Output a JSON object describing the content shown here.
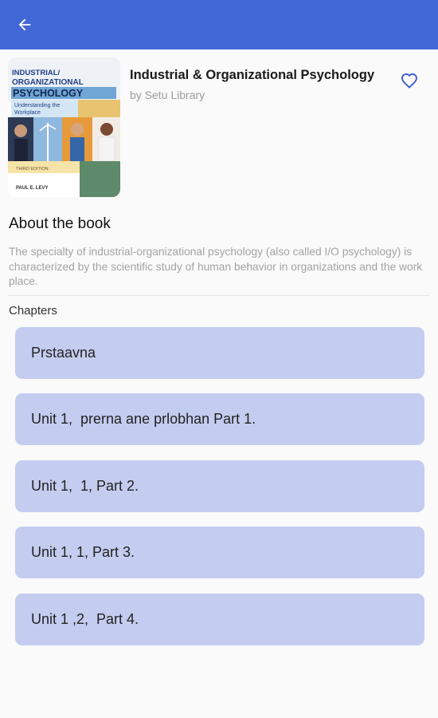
{
  "colors": {
    "appbar": "#4267d6",
    "chapter_bg": "#c4cdf0",
    "heart": "#3b5fd0",
    "muted_text": "#a3a3a3"
  },
  "appbar": {
    "back_icon": "arrow-left-icon"
  },
  "book": {
    "title": "Industrial & Organizational Psychology",
    "author": "by Setu Library",
    "favorite_icon": "heart-outline-icon",
    "cover": {
      "line1": "INDUSTRIAL/",
      "line2": "ORGANIZATIONAL",
      "line3": "PSYCHOLOGY",
      "subtitle1": "Understanding the",
      "subtitle2": "Workplace",
      "edition": "THIRD EDITION",
      "author": "PAUL E. LEVY"
    }
  },
  "about": {
    "heading": "About the book",
    "text": "The specialty of industrial-organizational psychology (also called I/O psychology) is characterized by the scientific study of human behavior in organizations and the work place."
  },
  "chapters": {
    "label": "Chapters",
    "items": [
      {
        "label": "Prstaavna"
      },
      {
        "label": "Unit 1,  prerna ane prlobhan Part 1."
      },
      {
        "label": "Unit 1,  1, Part 2."
      },
      {
        "label": "Unit 1, 1, Part 3."
      },
      {
        "label": "Unit 1 ,2,  Part 4."
      }
    ]
  }
}
